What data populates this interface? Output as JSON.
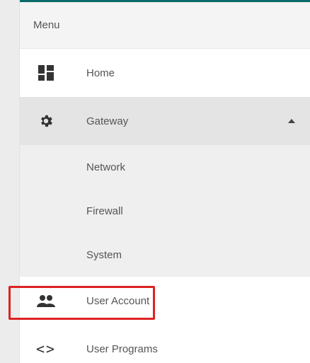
{
  "menu": {
    "header": "Menu",
    "items": [
      {
        "label": "Home",
        "icon": "dashboard-icon"
      },
      {
        "label": "Gateway",
        "icon": "gear-icon",
        "expanded": true
      },
      {
        "label": "User Account",
        "icon": "people-icon",
        "highlighted": true
      },
      {
        "label": "User Programs",
        "icon": "code-brackets-icon",
        "glyph": "<>"
      }
    ],
    "gateway_children": [
      "Network",
      "Firewall",
      "System"
    ]
  },
  "colors": {
    "highlight_border": "#dd2222",
    "top_accent": "#0b6b6b",
    "active_row": "#e4e4e4"
  }
}
